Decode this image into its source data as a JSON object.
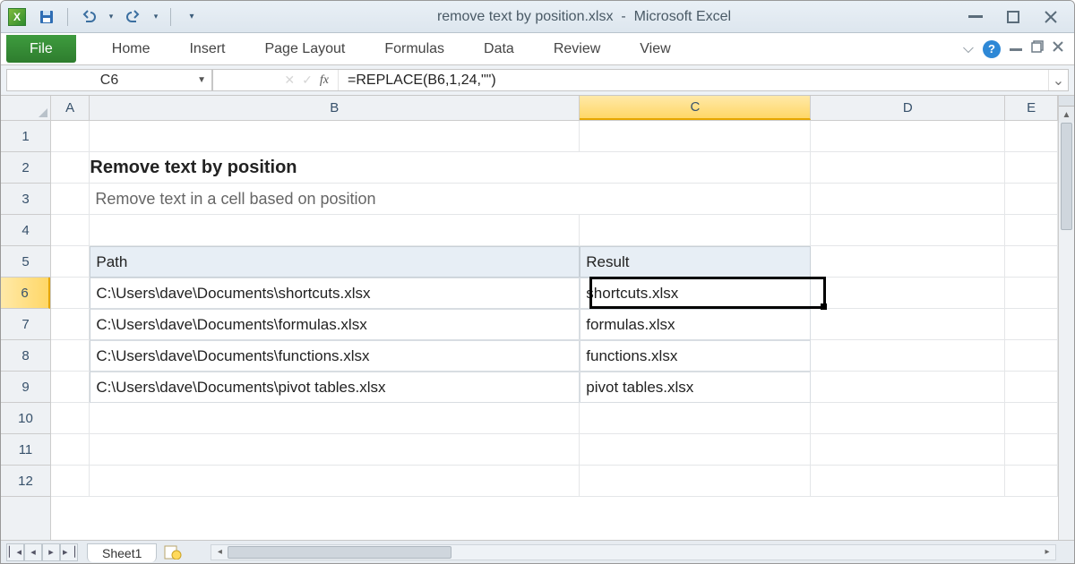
{
  "title": {
    "filename": "remove text by position.xlsx",
    "app": "Microsoft Excel"
  },
  "ribbon": {
    "file": "File",
    "tabs": [
      "Home",
      "Insert",
      "Page Layout",
      "Formulas",
      "Data",
      "Review",
      "View"
    ]
  },
  "formula_bar": {
    "name_box": "C6",
    "fx_label": "fx",
    "formula": "=REPLACE(B6,1,24,\"\")"
  },
  "columns": [
    "A",
    "B",
    "C",
    "D",
    "E"
  ],
  "selected_column": "C",
  "rows": [
    "1",
    "2",
    "3",
    "4",
    "5",
    "6",
    "7",
    "8",
    "9",
    "10",
    "11",
    "12"
  ],
  "selected_row": "6",
  "content": {
    "title": "Remove text by position",
    "subtitle": "Remove text in a cell based on position",
    "headers": {
      "path": "Path",
      "result": "Result"
    },
    "data": [
      {
        "path": "C:\\Users\\dave\\Documents\\shortcuts.xlsx",
        "result": "shortcuts.xlsx"
      },
      {
        "path": "C:\\Users\\dave\\Documents\\formulas.xlsx",
        "result": "formulas.xlsx"
      },
      {
        "path": "C:\\Users\\dave\\Documents\\functions.xlsx",
        "result": "functions.xlsx"
      },
      {
        "path": "C:\\Users\\dave\\Documents\\pivot tables.xlsx",
        "result": "pivot tables.xlsx"
      }
    ]
  },
  "sheet_tabs": {
    "active": "Sheet1"
  }
}
